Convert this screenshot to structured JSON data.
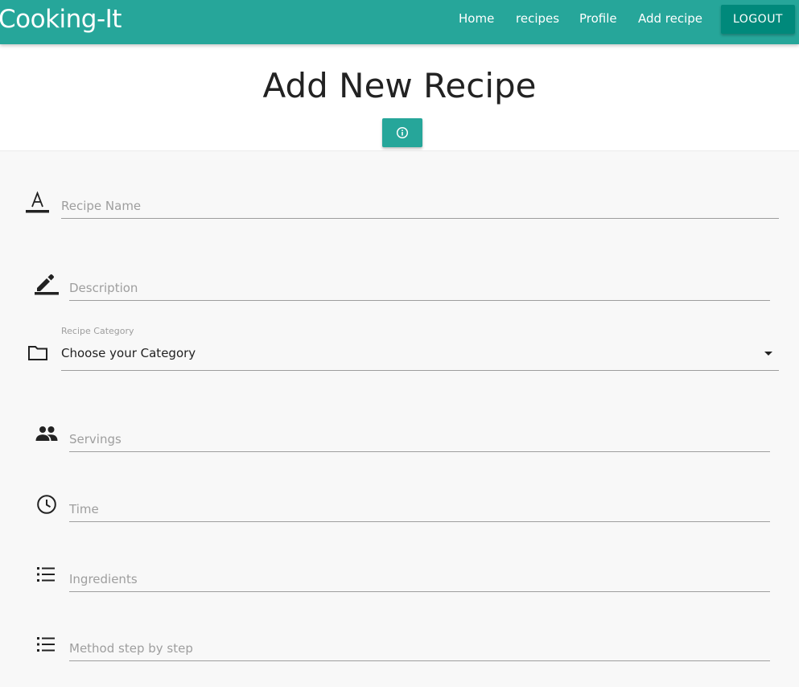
{
  "navbar": {
    "brand": "Cooking-It",
    "links": [
      "Home",
      "recipes",
      "Profile",
      "Add recipe"
    ],
    "logout_label": "LOGOUT",
    "color": "#26a69a",
    "logout_color": "#00897b"
  },
  "header": {
    "title": "Add New Recipe",
    "info_icon": "info-icon"
  },
  "form": {
    "recipe_name": {
      "placeholder": "Recipe Name",
      "value": "",
      "icon": "text-format-icon"
    },
    "description": {
      "placeholder": "Description",
      "value": "",
      "icon": "edit-icon"
    },
    "category": {
      "label": "Recipe Category",
      "selected": "Choose your Category",
      "icon": "folder-icon"
    },
    "servings": {
      "placeholder": "Servings",
      "value": "",
      "icon": "people-icon"
    },
    "time": {
      "placeholder": "Time",
      "value": "",
      "icon": "clock-icon"
    },
    "ingredients": {
      "placeholder": "Ingredients",
      "value": "",
      "icon": "list-icon"
    },
    "method": {
      "placeholder": "Method step by step",
      "value": "",
      "icon": "list-icon"
    }
  }
}
